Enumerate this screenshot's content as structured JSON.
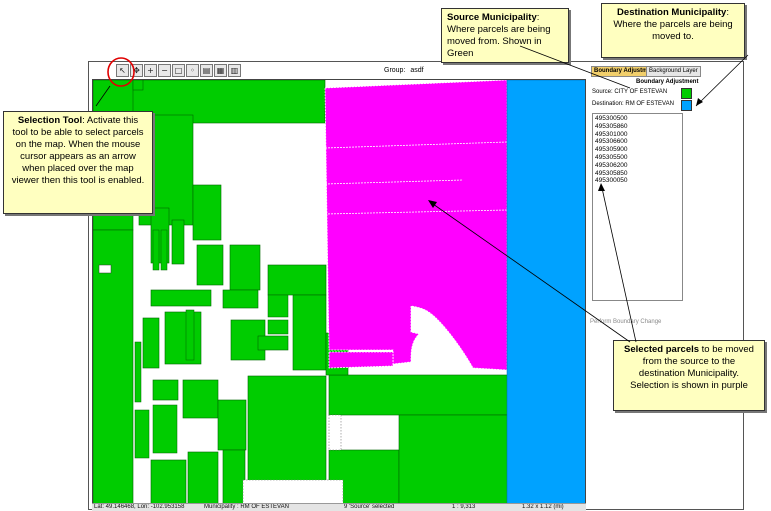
{
  "toolbar": {
    "tools": [
      {
        "name": "selection-tool",
        "glyph": "↖"
      },
      {
        "name": "pan-tool",
        "glyph": "✥"
      },
      {
        "name": "zoom-in-tool",
        "glyph": "+"
      },
      {
        "name": "zoom-out-tool",
        "glyph": "−"
      },
      {
        "name": "zoom-extent-tool",
        "glyph": "□"
      },
      {
        "name": "zoom-previous-tool",
        "glyph": "◦"
      },
      {
        "name": "print-tool",
        "glyph": "▤"
      },
      {
        "name": "layers-tool",
        "glyph": "▦"
      },
      {
        "name": "legend-tool",
        "glyph": "▥"
      }
    ],
    "group_label": "Group:",
    "group_value": "asdf"
  },
  "panel": {
    "tabs": [
      "Boundary Adjustment",
      "Background Layer"
    ],
    "title": "Boundary Adjustment",
    "source_label": "Source:",
    "source_value": "CITY OF ESTEVAN",
    "source_color": "#00cc00",
    "destination_label": "Destination:",
    "destination_value": "RM OF ESTEVAN",
    "destination_color": "#00a2ff",
    "parcels": [
      "495300500",
      "495305860",
      "495301000",
      "495306600",
      "495305900",
      "495305500",
      "495306200",
      "495305850",
      "495300050"
    ],
    "perform_label": "Perform Boundary Change"
  },
  "statusbar": {
    "coords": "Lat: 49.146468, Lon: -102.953158",
    "municipality": "Municipality : RM OF ESTEVAN",
    "selected": "9 'Source' selected",
    "scale": "1 : 9,313",
    "extent": "1.32 x 1.12 (mi)"
  },
  "callouts": {
    "source": {
      "title": "Source Municipality",
      "text": "Where parcels are being moved from. Shown in Green"
    },
    "destination": {
      "title": "Destination Municipality",
      "text": "Where the parcels are being moved to."
    },
    "selection_tool": {
      "title": "Selection Tool",
      "text": "Activate this tool to be able to select parcels on the map.  When the mouse cursor appears as an arrow when placed over the map viewer then this tool is enabled."
    },
    "selected_parcels": {
      "title": "Selected parcels",
      "text": "to be moved from the source to the destination Municipality.  Selection is shown in purple"
    }
  },
  "colors": {
    "source_green": "#00cc00",
    "selection_purple": "#ff00ff",
    "destination_blue": "#00a2ff",
    "callout_fill": "#ffffc0",
    "highlight_circle": "#ff0000"
  }
}
